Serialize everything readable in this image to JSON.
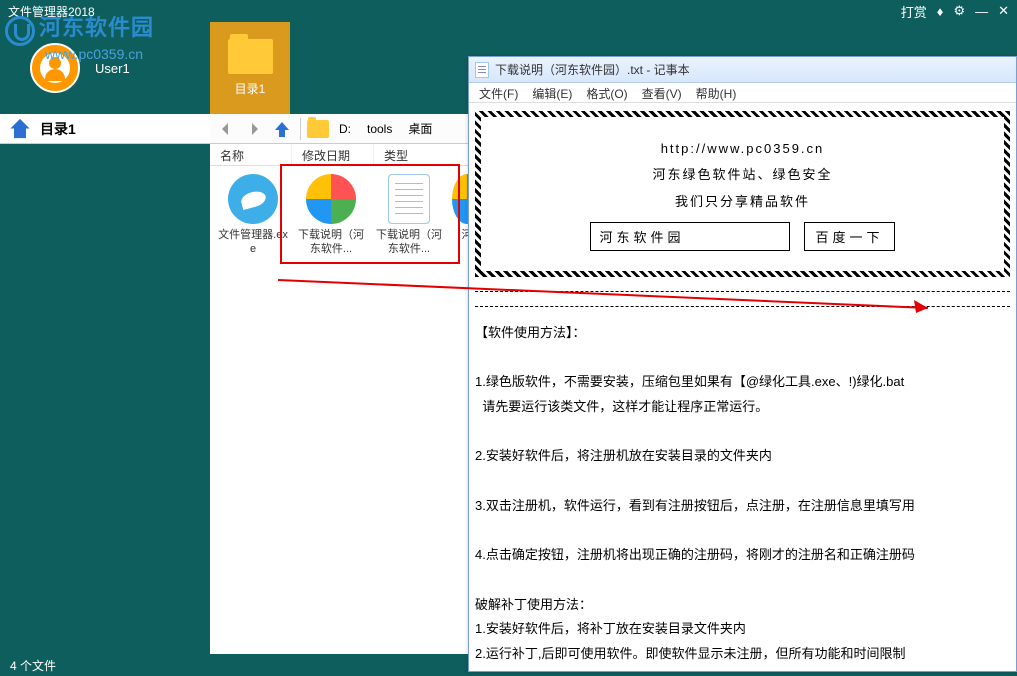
{
  "titlebar": {
    "app_title": "文件管理器2018",
    "donate": "打赏"
  },
  "watermark": {
    "text": "河东软件园",
    "url": "www.pc0359.cn"
  },
  "user": {
    "name": "User1"
  },
  "dir_tab": {
    "label": "目录1"
  },
  "left": {
    "current_dir": "目录1"
  },
  "nav": {
    "crumb_drive": "D:",
    "crumb1": "tools",
    "crumb2": "桌面"
  },
  "columns": {
    "name": "名称",
    "date": "修改日期",
    "type": "类型"
  },
  "files": [
    {
      "label": "文件管理器.exe"
    },
    {
      "label": "下载说明（河东软件..."
    },
    {
      "label": "下载说明（河东软件..."
    },
    {
      "label": "河"
    }
  ],
  "status": {
    "count": "4 个文件"
  },
  "notepad": {
    "title": "下载说明（河东软件园）.txt - 记事本",
    "menu": {
      "file": "文件(F)",
      "edit": "编辑(E)",
      "format": "格式(O)",
      "view": "查看(V)",
      "help": "帮助(H)"
    },
    "banner": {
      "url": "http://www.pc0359.cn",
      "line1": "河东绿色软件站、绿色安全",
      "line2": "我们只分享精品软件",
      "search_text": "河东软件园",
      "search_btn": "百度一下"
    },
    "body": "【软件使用方法】：\n\n1.绿色版软件，不需要安装，压缩包里如果有【@绿化工具.exe、!)绿化.bat\n  请先要运行该类文件，这样才能让程序正常运行。\n\n2.安装好软件后，将注册机放在安装目录的文件夹内\n\n3.双击注册机，软件运行，看到有注册按钮后，点注册，在注册信息里填写用\n\n4.点击确定按钮，注册机将出现正确的注册码，将刚才的注册名和正确注册码\n\n破解补丁使用方法：\n1.安装好软件后，将补丁放在安装目录文件夹内\n2.运行补丁,后即可使用软件。即使软件显示未注册，但所有功能和时间限制"
  }
}
